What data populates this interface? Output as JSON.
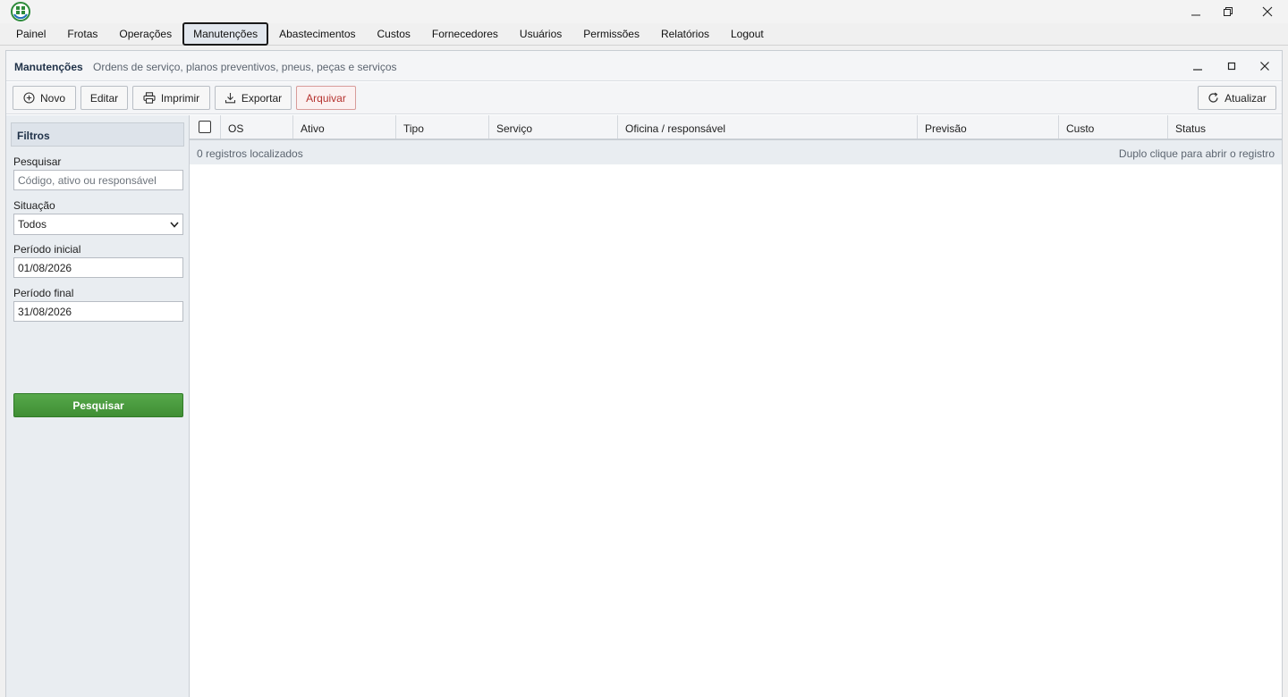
{
  "window": {
    "app_logo": "fleet-app-logo",
    "controls": [
      "minimize",
      "restore",
      "close"
    ]
  },
  "menu": {
    "items": [
      {
        "label": "Painel"
      },
      {
        "label": "Frotas"
      },
      {
        "label": "Operações"
      },
      {
        "label": "Manutenções",
        "active": true
      },
      {
        "label": "Abastecimentos"
      },
      {
        "label": "Custos"
      },
      {
        "label": "Fornecedores"
      },
      {
        "label": "Usuários"
      },
      {
        "label": "Permissões"
      },
      {
        "label": "Relatórios"
      },
      {
        "label": "Logout"
      }
    ]
  },
  "module": {
    "title": "Manutenções",
    "subtitle": "Ordens de serviço, planos preventivos, pneus, peças e serviços"
  },
  "toolbar": {
    "new_label": "Novo",
    "edit_label": "Editar",
    "print_label": "Imprimir",
    "export_label": "Exportar",
    "archive_label": "Arquivar",
    "refresh_label": "Atualizar"
  },
  "filters": {
    "title": "Filtros",
    "search_label": "Pesquisar",
    "search_placeholder": "Código, ativo ou responsável",
    "status_label": "Situação",
    "status_value": "Todos",
    "start_label": "Período inicial",
    "start_value": "01/08/2026",
    "end_label": "Período final",
    "end_value": "31/08/2026",
    "search_button": "Pesquisar"
  },
  "grid": {
    "columns": {
      "os": "OS",
      "ativo": "Ativo",
      "tipo": "Tipo",
      "servico": "Serviço",
      "oficina": "Oficina / responsável",
      "previsao": "Previsão",
      "custo": "Custo",
      "status": "Status"
    },
    "records_text": "0 registros localizados",
    "hint_text": "Duplo clique para abrir o registro",
    "rows": []
  },
  "colors": {
    "accent_green": "#3f8e34",
    "danger": "#b5332f",
    "title_blue": "#1f3148"
  }
}
